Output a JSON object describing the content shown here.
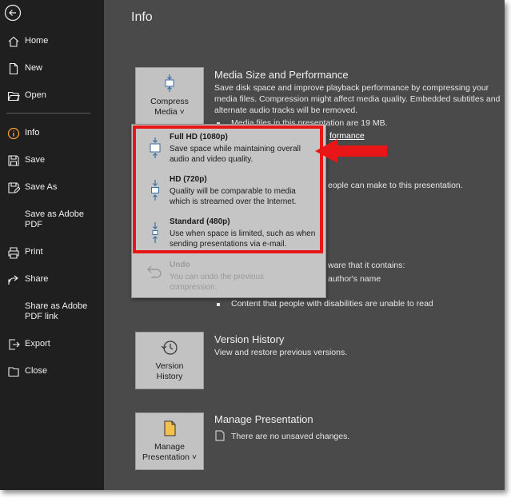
{
  "page": {
    "title": "Info"
  },
  "sidebar": {
    "items": [
      {
        "label": "Home"
      },
      {
        "label": "New"
      },
      {
        "label": "Open"
      },
      {
        "label": "Info"
      },
      {
        "label": "Save"
      },
      {
        "label": "Save As"
      },
      {
        "label": "Save as Adobe\nPDF"
      },
      {
        "label": "Print"
      },
      {
        "label": "Share"
      },
      {
        "label": "Share as Adobe\nPDF link"
      },
      {
        "label": "Export"
      },
      {
        "label": "Close"
      }
    ]
  },
  "media": {
    "heading": "Media Size and Performance",
    "button_label": "Compress\nMedia ˅",
    "desc": "Save disk space and improve playback performance by compressing your media files. Compression might affect media quality. Embedded subtitles and alternate audio tracks will be removed.",
    "bullet1": "Media files in this presentation are 19 MB.",
    "link": "formance"
  },
  "protect": {
    "text": "eople can make to this presentation."
  },
  "inspect": {
    "line1": "ware that it contains:",
    "line2": "author's name",
    "line3": "Content that people with disabilities are unable to read"
  },
  "version": {
    "heading": "Version History",
    "desc": "View and restore previous versions.",
    "button_label": "Version\nHistory"
  },
  "manage": {
    "heading": "Manage Presentation",
    "desc": "There are no unsaved changes.",
    "button_label": "Manage\nPresentation ˅"
  },
  "dropdown": {
    "options": [
      {
        "title": "Full HD (1080p)",
        "desc": "Save space while maintaining overall audio and video quality."
      },
      {
        "title": "HD (720p)",
        "desc": "Quality will be comparable to media which is streamed over the Internet."
      },
      {
        "title": "Standard (480p)",
        "desc": "Use when space is limited, such as when sending presentations via e-mail."
      },
      {
        "title": "Undo",
        "desc": "You can undo the previous compression."
      }
    ]
  },
  "colors": {
    "highlight": "#e81616",
    "sidebar_bg": "#1f1f1f",
    "main_bg": "#4a4a4a"
  },
  "icons": [
    "back-arrow-icon",
    "home-icon",
    "new-document-icon",
    "open-folder-icon",
    "info-icon",
    "save-icon",
    "save-as-icon",
    "print-icon",
    "share-icon",
    "export-icon",
    "close-icon",
    "compress-media-icon",
    "version-history-icon",
    "manage-presentation-icon",
    "undo-icon",
    "document-check-icon"
  ]
}
